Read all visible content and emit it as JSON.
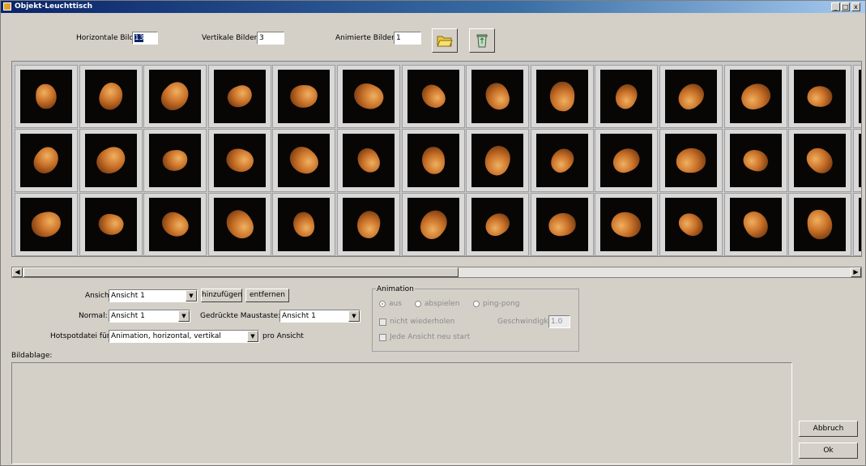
{
  "window": {
    "title": "Objekt-Leuchttisch",
    "controls": [
      "_",
      "□",
      "x"
    ]
  },
  "top": {
    "horizontal_label": "Horizontale Bilder:",
    "horizontal_value": "13",
    "vertical_label": "Vertikale Bilder:",
    "vertical_value": "3",
    "animated_label": "Animierte Bilder:",
    "animated_value": "1",
    "open_icon": "folder-open-icon",
    "delete_icon": "recycle-bin-icon"
  },
  "grid": {
    "rows": 3,
    "columns": 13,
    "thumbnail_kind": "3d-fetus-render"
  },
  "view": {
    "ansicht_label": "Ansicht:",
    "ansicht_value": "Ansicht 1",
    "add_button": "hinzufügen",
    "remove_button": "entfernen",
    "normal_label": "Normal:",
    "normal_value": "Ansicht 1",
    "pressed_label": "Gedrückte Maustaste:",
    "pressed_value": "Ansicht 1",
    "hotspot_label": "Hotspotdatei für",
    "hotspot_value": "Animation, horizontal, vertikal",
    "per_view_label": "pro Ansicht"
  },
  "animation": {
    "group_label": "Animation",
    "radio_off": "aus",
    "radio_play": "abspielen",
    "radio_pingpong": "ping-pong",
    "no_repeat": "nicht wiederholen",
    "speed_label": "Geschwindigkeit:",
    "speed_value": "1.0",
    "each_view_restart": "Jede Ansicht neu start"
  },
  "storage": {
    "label": "Bildablage:"
  },
  "buttons": {
    "cancel": "Abbruch",
    "ok": "Ok"
  }
}
